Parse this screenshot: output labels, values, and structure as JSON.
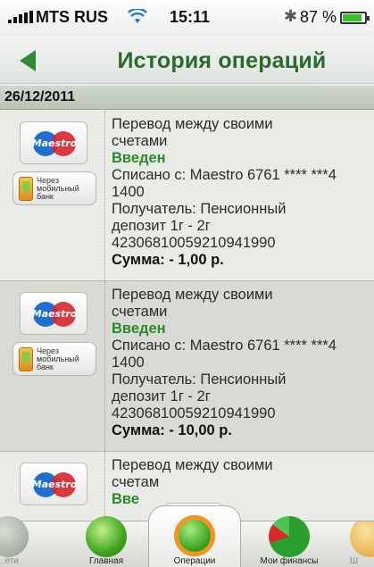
{
  "status_bar": {
    "carrier": "MTS RUS",
    "time": "15:11",
    "battery": "87 %",
    "battery_level": 0.87
  },
  "nav": {
    "title": "История операций"
  },
  "date": "26/12/2011",
  "transactions": [
    {
      "card_brand": "Maestro",
      "channel": "Через мобильный банк",
      "title1": "Перевод между своими",
      "title2": "счетами",
      "status": "Введен",
      "debit1": "Списано с: Maestro 6761 **** ***4",
      "debit2": "1400",
      "recipient1": "Получатель: Пенсионный",
      "recipient2": "депозит 1г - 2г",
      "account": "42306810059210941990",
      "sum": "Сумма: - 1,00 р."
    },
    {
      "card_brand": "Maestro",
      "channel": "Через мобильный банк",
      "title1": "Перевод между своими",
      "title2": "счетами",
      "status": "Введен",
      "debit1": "Списано с: Maestro 6761 **** ***4",
      "debit2": "1400",
      "recipient1": "Получатель: Пенсионный",
      "recipient2": "депозит 1г - 2г",
      "account": "42306810059210941990",
      "sum": "Сумма: - 10,00 р."
    },
    {
      "card_brand": "Maestro",
      "title1": "Перевод между своими",
      "title2": "счетам",
      "status": "Вве"
    }
  ],
  "tabs": [
    {
      "label": "...ети",
      "icon": "side-icon"
    },
    {
      "label": "Главная",
      "icon": "home-icon"
    },
    {
      "label": "Операции",
      "icon": "operations-icon"
    },
    {
      "label": "Мои финансы",
      "icon": "finance-pie-icon"
    },
    {
      "label": "Ш",
      "icon": "side-icon"
    }
  ],
  "colors": {
    "accent_green": "#2a6a2a",
    "status_green": "#2c8a2c",
    "tab_active_orange": "#f49522"
  }
}
